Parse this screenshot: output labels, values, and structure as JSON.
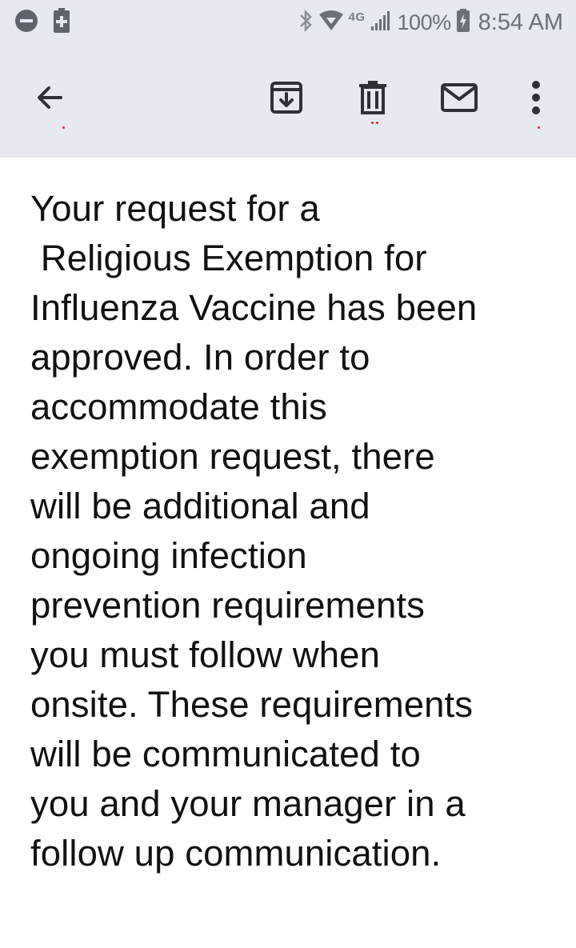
{
  "status_bar": {
    "network_type": "4G",
    "battery_percent": "100%",
    "time": "8:54 AM",
    "icons": [
      "do-not-disturb-icon",
      "battery-saver-icon",
      "bluetooth-icon",
      "wifi-icon",
      "signal-icon",
      "battery-charging-icon"
    ]
  },
  "toolbar": {
    "icons": [
      "back-arrow-icon",
      "archive-icon",
      "delete-icon",
      "mark-unread-icon",
      "more-options-icon"
    ]
  },
  "message": {
    "body": "Your request for a\n Religious Exemption for\nInfluenza Vaccine has been\napproved. In order to\naccommodate this\nexemption request, there\nwill be additional and\nongoing infection\nprevention requirements\nyou must follow when\nonsite. These requirements\nwill be communicated to\nyou and your manager in a\nfollow up communication."
  },
  "colors": {
    "header_background": "#e6e9f0",
    "icon_color": "#2f3136",
    "status_text": "#6b6f78",
    "body_text": "#111111"
  }
}
